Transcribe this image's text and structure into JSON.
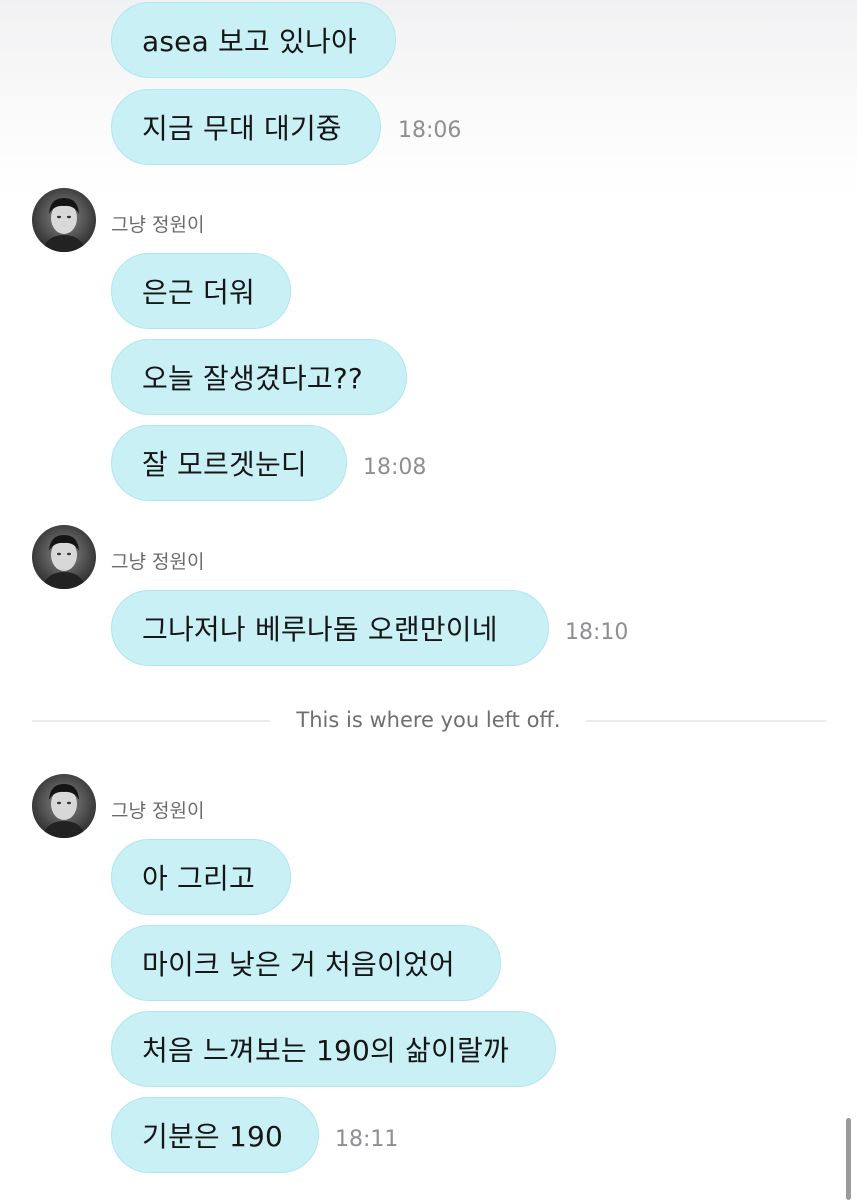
{
  "messages": {
    "m1": "asea 보고 있나아",
    "m2": "지금 무대 대기즁",
    "m3": "은근 더워",
    "m4": "오늘 잘생겼다고??",
    "m5": "잘 모르겟눈디",
    "m6": "그나저나 베루나돔 오랜만이네",
    "m7": "아 그리고",
    "m8": "마이크 낮은 거 처음이었어",
    "m9": "처음 느껴보는 190의 삶이랄까",
    "m10": "기분은 190"
  },
  "times": {
    "t1": "18:06",
    "t2": "18:08",
    "t3": "18:10",
    "t4": "18:11"
  },
  "sender": {
    "name": "그냥 정원이"
  },
  "divider": {
    "text": "This is where you left off."
  }
}
